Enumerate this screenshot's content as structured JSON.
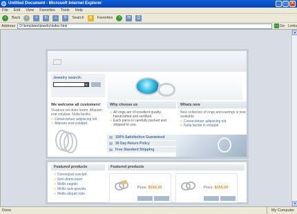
{
  "window": {
    "title": "Untitled Document - Microsoft Internet Explorer",
    "buttons": [
      "_",
      "□",
      "×"
    ]
  },
  "menu": [
    "File",
    "Edit",
    "View",
    "Favorites",
    "Tools",
    "Help"
  ],
  "toolbar": {
    "back_label": "Back",
    "search_label": "Search",
    "favorites_label": "Favorites"
  },
  "address": {
    "label": "Address",
    "value": "D:\\templates\\jewelry\\index.html",
    "go_label": "Go",
    "links_label": "Links"
  },
  "status": {
    "text": "Done",
    "zone": "My Computer"
  },
  "page": {
    "jewelry_search": {
      "label": "Jewelry search:"
    },
    "welcome": {
      "title": "We welcome all customers!",
      "text": "Vivamus vel dolor lorem. Aliquam erat volutpat. Nulla facilisi.",
      "links": [
        "Consectetuer adipiscing elit",
        "Aliquam erat volutpat"
      ]
    },
    "why_choose": {
      "header": "Why choose us",
      "items": [
        "All rings are of excellent quality, handcrafted and certified.",
        "Each piece is carefully packed and shipped to you."
      ]
    },
    "whats_new": {
      "header": "Whats new",
      "text": "New collection of rings and earrings is now available.",
      "links": [
        "Consectetuer adipiscing elit",
        "Nulla facilisi in volutpat"
      ]
    },
    "promos": [
      "100% Satisfaction Guaranteed",
      "30 Day Return Policy",
      "Free Standard Shipping"
    ],
    "featured_left": {
      "header": "Featured products",
      "items": [
        "Consequat suscipit",
        "Sed ullamcorper",
        "Mollis sagittis",
        "Mollis quis gravida",
        "Mollis aliquet odio"
      ]
    },
    "featured_right": {
      "header": "Featured products",
      "products": [
        {
          "price_label": "Price:",
          "price": "$150.00"
        },
        {
          "price_label": "Price:",
          "price": "$150.00"
        }
      ]
    }
  }
}
